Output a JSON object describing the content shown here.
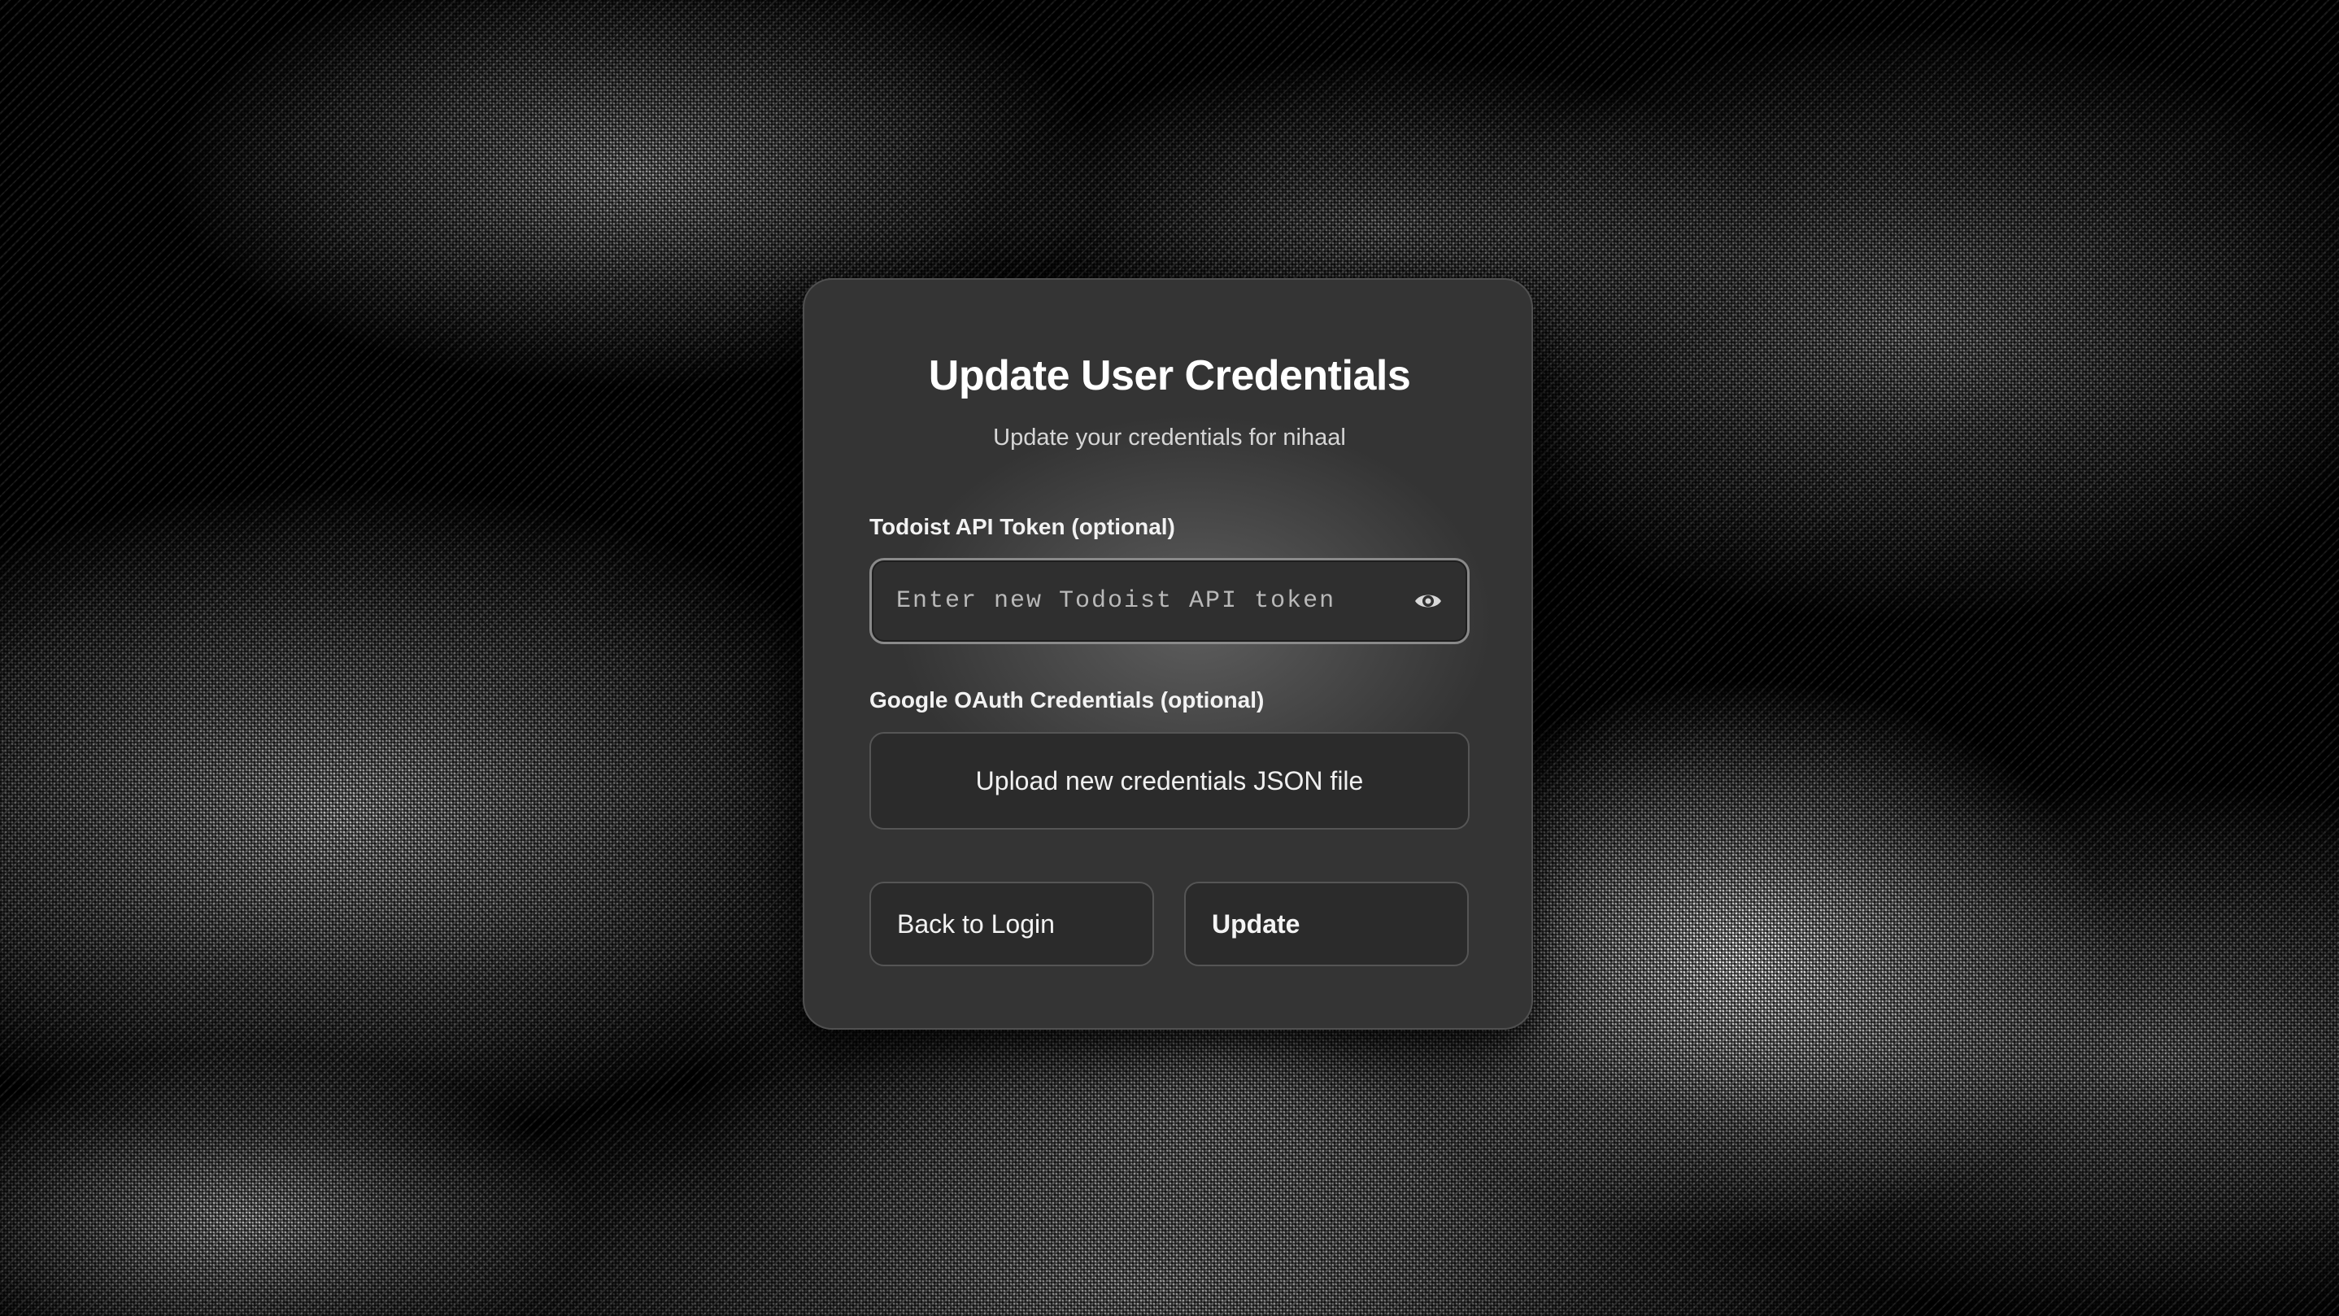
{
  "card": {
    "title": "Update User Credentials",
    "subtitle": "Update your credentials for nihaal"
  },
  "token_field": {
    "label": "Todoist API Token (optional)",
    "placeholder": "Enter new Todoist API token",
    "value": "",
    "toggle_icon": "eye-icon"
  },
  "oauth_field": {
    "label": "Google OAuth Credentials (optional)",
    "upload_label": "Upload new credentials JSON file"
  },
  "actions": {
    "back_label": "Back to Login",
    "update_label": "Update"
  },
  "colors": {
    "background": "#000000",
    "card": "#3a3a3a",
    "input_border": "#8a8a8a",
    "button": "#2b2b2b",
    "text": "#ffffff"
  }
}
